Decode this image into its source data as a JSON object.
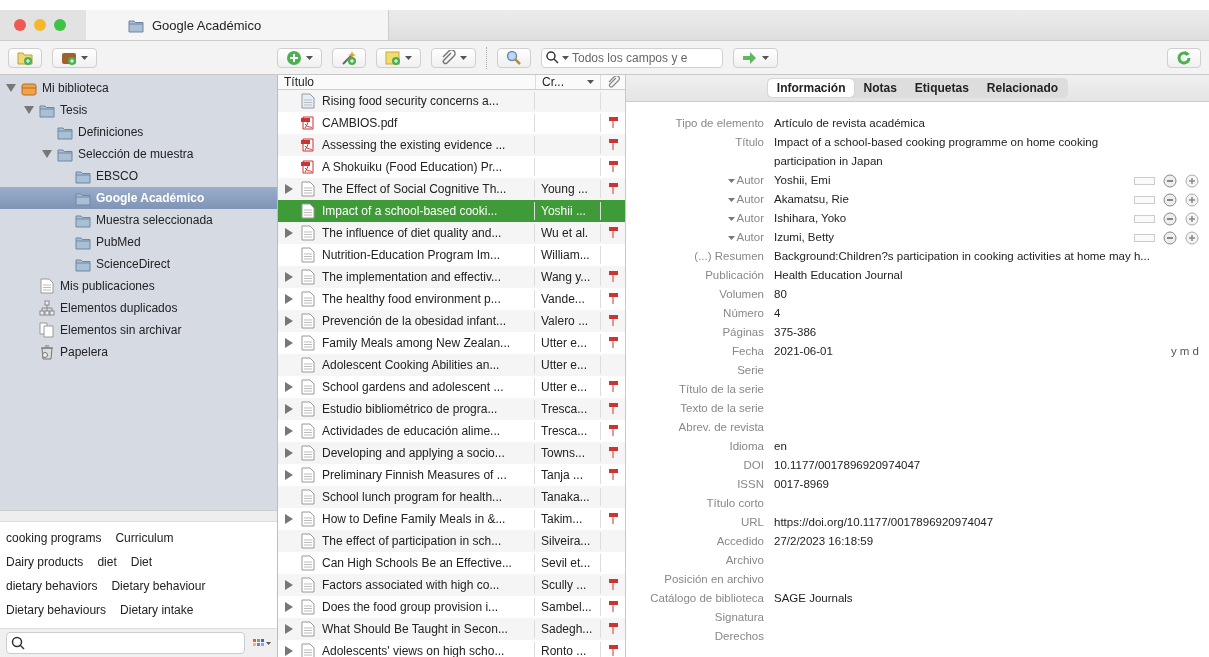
{
  "window": {
    "tab": {
      "title": "Google Académico"
    }
  },
  "toolbar": {
    "search": {
      "placeholder": "Todos los campos y e"
    }
  },
  "collections": [
    {
      "label": "Mi biblioteca",
      "kind": "library",
      "selected": false,
      "expanded": true,
      "children": [
        {
          "label": "Tesis",
          "kind": "folder",
          "selected": false,
          "expanded": true,
          "children": [
            {
              "label": "Definiciones",
              "kind": "folder",
              "selected": false
            },
            {
              "label": "Selección de muestra",
              "kind": "folder",
              "selected": false,
              "expanded": true,
              "children": [
                {
                  "label": "EBSCO",
                  "kind": "folder",
                  "selected": false
                },
                {
                  "label": "Google Académico",
                  "kind": "folder",
                  "selected": true
                },
                {
                  "label": "Muestra seleccionada",
                  "kind": "folder",
                  "selected": false
                },
                {
                  "label": "PubMed",
                  "kind": "folder",
                  "selected": false
                },
                {
                  "label": "ScienceDirect",
                  "kind": "folder",
                  "selected": false
                }
              ]
            }
          ]
        },
        {
          "label": "Mis publicaciones",
          "kind": "publications",
          "selected": false
        },
        {
          "label": "Elementos duplicados",
          "kind": "duplicates",
          "selected": false
        },
        {
          "label": "Elementos sin archivar",
          "kind": "unfiled",
          "selected": false
        },
        {
          "label": "Papelera",
          "kind": "trash",
          "selected": false
        }
      ]
    }
  ],
  "tags": [
    [
      "cooking programs",
      "Curriculum"
    ],
    [
      "Dairy products",
      "diet",
      "Diet"
    ],
    [
      "dietary behaviors",
      "Dietary behaviour"
    ],
    [
      "Dietary behaviours",
      "Dietary intake"
    ]
  ],
  "items": {
    "columns": [
      "Título",
      "Cr..."
    ],
    "rows": [
      {
        "kind": "webpage",
        "title": "Rising food security concerns a...",
        "creator": "",
        "has_children": false,
        "has_pdf": false,
        "selected": false
      },
      {
        "kind": "pdf",
        "title": "CAMBIOS.pdf",
        "creator": "",
        "has_children": false,
        "has_pdf": true,
        "selected": false
      },
      {
        "kind": "pdf",
        "title": "Assessing the existing evidence ...",
        "creator": "",
        "has_children": false,
        "has_pdf": true,
        "selected": false
      },
      {
        "kind": "pdf",
        "title": "A Shokuiku (Food Education) Pr...",
        "creator": "",
        "has_children": false,
        "has_pdf": true,
        "selected": false
      },
      {
        "kind": "article",
        "title": "The Effect of Social Cognitive Th...",
        "creator": "Young ...",
        "has_children": true,
        "has_pdf": true,
        "selected": false
      },
      {
        "kind": "article",
        "title": "Impact of a school-based cooki...",
        "creator": "Yoshii ...",
        "has_children": false,
        "has_pdf": false,
        "selected": true
      },
      {
        "kind": "article",
        "title": "The influence of diet quality and...",
        "creator": "Wu et al.",
        "has_children": true,
        "has_pdf": true,
        "selected": false
      },
      {
        "kind": "article",
        "title": "Nutrition-Education Program Im...",
        "creator": "William...",
        "has_children": false,
        "has_pdf": false,
        "selected": false
      },
      {
        "kind": "article",
        "title": "The implementation and effectiv...",
        "creator": "Wang y...",
        "has_children": true,
        "has_pdf": true,
        "selected": false
      },
      {
        "kind": "article",
        "title": "The healthy food environment p...",
        "creator": "Vande...",
        "has_children": true,
        "has_pdf": true,
        "selected": false
      },
      {
        "kind": "article",
        "title": "Prevención de la obesidad infant...",
        "creator": "Valero ...",
        "has_children": true,
        "has_pdf": true,
        "selected": false
      },
      {
        "kind": "article",
        "title": "Family Meals among New Zealan...",
        "creator": "Utter e...",
        "has_children": true,
        "has_pdf": true,
        "selected": false
      },
      {
        "kind": "article",
        "title": "Adolescent Cooking Abilities an...",
        "creator": "Utter e...",
        "has_children": false,
        "has_pdf": false,
        "selected": false
      },
      {
        "kind": "article",
        "title": "School gardens and adolescent ...",
        "creator": "Utter e...",
        "has_children": true,
        "has_pdf": true,
        "selected": false
      },
      {
        "kind": "article",
        "title": "Estudio bibliométrico de progra...",
        "creator": "Tresca...",
        "has_children": true,
        "has_pdf": true,
        "selected": false
      },
      {
        "kind": "article",
        "title": "Actividades de educación alime...",
        "creator": "Tresca...",
        "has_children": true,
        "has_pdf": true,
        "selected": false
      },
      {
        "kind": "article",
        "title": "Developing and applying a socio...",
        "creator": "Towns...",
        "has_children": true,
        "has_pdf": true,
        "selected": false
      },
      {
        "kind": "article",
        "title": "Preliminary Finnish Measures of ...",
        "creator": "Tanja ...",
        "has_children": true,
        "has_pdf": true,
        "selected": false
      },
      {
        "kind": "article",
        "title": "School lunch program for health...",
        "creator": "Tanaka...",
        "has_children": false,
        "has_pdf": false,
        "selected": false
      },
      {
        "kind": "article",
        "title": "How to Define Family Meals in &...",
        "creator": "Takim...",
        "has_children": true,
        "has_pdf": true,
        "selected": false
      },
      {
        "kind": "article",
        "title": "The effect of participation in sch...",
        "creator": "Silveira...",
        "has_children": false,
        "has_pdf": false,
        "selected": false
      },
      {
        "kind": "article",
        "title": "Can High Schools Be an Effective...",
        "creator": "Sevil et...",
        "has_children": false,
        "has_pdf": false,
        "selected": false
      },
      {
        "kind": "article",
        "title": "Factors associated with high co...",
        "creator": "Scully ...",
        "has_children": true,
        "has_pdf": true,
        "selected": false
      },
      {
        "kind": "article",
        "title": "Does the food group provision i...",
        "creator": "Sambel...",
        "has_children": true,
        "has_pdf": true,
        "selected": false
      },
      {
        "kind": "article",
        "title": "What Should Be Taught in Secon...",
        "creator": "Sadegh...",
        "has_children": true,
        "has_pdf": true,
        "selected": false
      },
      {
        "kind": "article",
        "title": "Adolescents' views on high scho...",
        "creator": "Ronto ...",
        "has_children": true,
        "has_pdf": true,
        "selected": false
      }
    ]
  },
  "item_pane": {
    "tabs": [
      {
        "label": "Información",
        "selected": true
      },
      {
        "label": "Notas",
        "selected": false
      },
      {
        "label": "Etiquetas",
        "selected": false
      },
      {
        "label": "Relacionado",
        "selected": false
      }
    ],
    "fields": [
      {
        "kind": "text",
        "label": "Tipo de elemento",
        "value": "Artículo de revista académica"
      },
      {
        "kind": "text",
        "label": "Título",
        "value": "Impact of a school-based cooking programme on home cooking participation in Japan"
      },
      {
        "kind": "creator",
        "label": "Autor",
        "value": "Yoshii, Emi"
      },
      {
        "kind": "creator",
        "label": "Autor",
        "value": "Akamatsu, Rie"
      },
      {
        "kind": "creator",
        "label": "Autor",
        "value": "Ishihara, Yoko"
      },
      {
        "kind": "creator",
        "label": "Autor",
        "value": "Izumi, Betty"
      },
      {
        "kind": "text",
        "label": "(...) Resumen",
        "value": "Background:Children?s participation in cooking activities at home may h..."
      },
      {
        "kind": "text",
        "label": "Publicación",
        "value": "Health Education Journal"
      },
      {
        "kind": "text",
        "label": "Volumen",
        "value": "80"
      },
      {
        "kind": "text",
        "label": "Número",
        "value": "4"
      },
      {
        "kind": "text",
        "label": "Páginas",
        "value": "375-386"
      },
      {
        "kind": "date",
        "label": "Fecha",
        "value": "2021-06-01",
        "hint": "y m d"
      },
      {
        "kind": "text",
        "label": "Serie"
      },
      {
        "kind": "text",
        "label": "Título de la serie"
      },
      {
        "kind": "text",
        "label": "Texto de la serie"
      },
      {
        "kind": "text",
        "label": "Abrev. de revista"
      },
      {
        "kind": "text",
        "label": "Idioma",
        "value": "en"
      },
      {
        "kind": "text",
        "label": "DOI",
        "value": "10.1177/0017896920974047"
      },
      {
        "kind": "text",
        "label": "ISSN",
        "value": "0017-8969"
      },
      {
        "kind": "text",
        "label": "Título corto"
      },
      {
        "kind": "text",
        "label": "URL",
        "value": "https://doi.org/10.1177/0017896920974047"
      },
      {
        "kind": "text",
        "label": "Accedido",
        "value": "27/2/2023 16:18:59"
      },
      {
        "kind": "text",
        "label": "Archivo"
      },
      {
        "kind": "text",
        "label": "Posición en archivo"
      },
      {
        "kind": "text",
        "label": "Catálogo de biblioteca",
        "value": "SAGE Journals"
      },
      {
        "kind": "text",
        "label": "Signatura"
      },
      {
        "kind": "text",
        "label": "Derechos"
      }
    ]
  }
}
